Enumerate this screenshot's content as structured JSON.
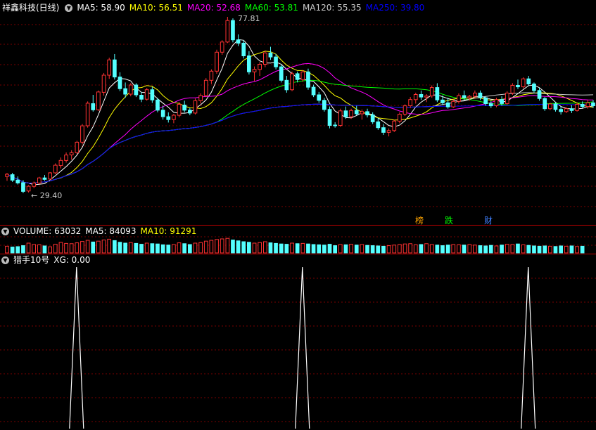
{
  "price_panel": {
    "title": "祥鑫科技(日线)",
    "ma_labels": [
      {
        "text": "MA5: 58.90",
        "color": "#ffffff"
      },
      {
        "text": "MA10: 56.51",
        "color": "#ffff00"
      },
      {
        "text": "MA20: 52.68",
        "color": "#ff00ff"
      },
      {
        "text": "MA60: 53.81",
        "color": "#00ff00"
      },
      {
        "text": "MA120: 55.35",
        "color": "#cccccc"
      },
      {
        "text": "MA250: 39.80",
        "color": "#0000ff"
      }
    ],
    "high_label": "77.81",
    "low_label": "← 29.40",
    "markers": [
      {
        "text": "榜",
        "color": "#ffa500"
      },
      {
        "text": "跌",
        "color": "#00ff00"
      },
      {
        "text": "财",
        "color": "#4080ff"
      }
    ]
  },
  "volume_panel": {
    "title": "VOLUME: 63032",
    "ma5": "MA5: 84093",
    "ma10": "MA10: 91291"
  },
  "indicator_panel": {
    "title": "猎手10号",
    "xg": "XG: 0.00"
  },
  "colors": {
    "up": "#ff3232",
    "down": "#54ffff",
    "grid": "#7a0000",
    "border": "#c00000"
  },
  "chart_data": {
    "type": "candlestick",
    "price_range": [
      29.4,
      77.81
    ],
    "candles": [
      {
        "o": 34.0,
        "h": 35.0,
        "l": 32.8,
        "c": 34.6
      },
      {
        "o": 34.5,
        "h": 35.0,
        "l": 32.5,
        "c": 33.0
      },
      {
        "o": 33.0,
        "h": 34.0,
        "l": 31.8,
        "c": 32.2
      },
      {
        "o": 32.3,
        "h": 33.0,
        "l": 29.4,
        "c": 29.9
      },
      {
        "o": 30.0,
        "h": 31.6,
        "l": 29.6,
        "c": 31.3
      },
      {
        "o": 31.3,
        "h": 32.6,
        "l": 30.8,
        "c": 32.2
      },
      {
        "o": 32.2,
        "h": 33.9,
        "l": 31.9,
        "c": 33.6
      },
      {
        "o": 33.6,
        "h": 34.4,
        "l": 32.8,
        "c": 33.2
      },
      {
        "o": 33.3,
        "h": 35.2,
        "l": 33.0,
        "c": 35.0
      },
      {
        "o": 35.0,
        "h": 37.6,
        "l": 34.6,
        "c": 37.1
      },
      {
        "o": 37.0,
        "h": 39.2,
        "l": 36.2,
        "c": 38.4
      },
      {
        "o": 38.4,
        "h": 40.6,
        "l": 37.8,
        "c": 39.9
      },
      {
        "o": 39.9,
        "h": 41.2,
        "l": 38.6,
        "c": 40.5
      },
      {
        "o": 40.5,
        "h": 43.8,
        "l": 40.1,
        "c": 43.4
      },
      {
        "o": 43.4,
        "h": 48.4,
        "l": 42.8,
        "c": 47.9
      },
      {
        "o": 47.9,
        "h": 54.6,
        "l": 47.4,
        "c": 54.1
      },
      {
        "o": 54.0,
        "h": 56.4,
        "l": 51.8,
        "c": 52.3
      },
      {
        "o": 52.3,
        "h": 57.6,
        "l": 52.0,
        "c": 57.2
      },
      {
        "o": 57.1,
        "h": 62.4,
        "l": 56.2,
        "c": 61.8
      },
      {
        "o": 61.8,
        "h": 66.6,
        "l": 60.8,
        "c": 66.0
      },
      {
        "o": 66.0,
        "h": 67.6,
        "l": 60.6,
        "c": 61.3
      },
      {
        "o": 61.3,
        "h": 62.6,
        "l": 57.4,
        "c": 58.1
      },
      {
        "o": 58.1,
        "h": 59.8,
        "l": 55.6,
        "c": 56.6
      },
      {
        "o": 56.6,
        "h": 59.6,
        "l": 56.0,
        "c": 59.1
      },
      {
        "o": 59.1,
        "h": 59.6,
        "l": 55.8,
        "c": 56.4
      },
      {
        "o": 56.3,
        "h": 57.2,
        "l": 54.4,
        "c": 55.2
      },
      {
        "o": 55.2,
        "h": 58.3,
        "l": 54.8,
        "c": 57.8
      },
      {
        "o": 57.8,
        "h": 58.6,
        "l": 54.2,
        "c": 55.0
      },
      {
        "o": 55.0,
        "h": 55.6,
        "l": 51.6,
        "c": 52.2
      },
      {
        "o": 52.2,
        "h": 53.4,
        "l": 49.6,
        "c": 50.4
      },
      {
        "o": 50.4,
        "h": 51.6,
        "l": 48.8,
        "c": 49.6
      },
      {
        "o": 49.6,
        "h": 51.2,
        "l": 48.6,
        "c": 50.8
      },
      {
        "o": 50.8,
        "h": 54.4,
        "l": 50.2,
        "c": 53.8
      },
      {
        "o": 53.6,
        "h": 54.8,
        "l": 51.6,
        "c": 52.2
      },
      {
        "o": 52.2,
        "h": 52.8,
        "l": 50.8,
        "c": 51.4
      },
      {
        "o": 51.4,
        "h": 55.4,
        "l": 51.0,
        "c": 54.8
      },
      {
        "o": 54.8,
        "h": 56.8,
        "l": 54.0,
        "c": 56.2
      },
      {
        "o": 56.2,
        "h": 61.0,
        "l": 55.8,
        "c": 60.4
      },
      {
        "o": 60.4,
        "h": 63.4,
        "l": 59.4,
        "c": 62.9
      },
      {
        "o": 62.9,
        "h": 68.8,
        "l": 62.2,
        "c": 68.1
      },
      {
        "o": 68.1,
        "h": 71.4,
        "l": 67.4,
        "c": 70.9
      },
      {
        "o": 70.9,
        "h": 77.81,
        "l": 70.6,
        "c": 76.8
      },
      {
        "o": 76.8,
        "h": 77.4,
        "l": 70.8,
        "c": 71.5
      },
      {
        "o": 71.5,
        "h": 73.0,
        "l": 69.8,
        "c": 70.6
      },
      {
        "o": 70.6,
        "h": 71.4,
        "l": 66.4,
        "c": 67.1
      },
      {
        "o": 67.1,
        "h": 68.4,
        "l": 62.0,
        "c": 62.7
      },
      {
        "o": 62.7,
        "h": 64.2,
        "l": 60.2,
        "c": 63.4
      },
      {
        "o": 63.4,
        "h": 65.4,
        "l": 61.6,
        "c": 64.8
      },
      {
        "o": 64.8,
        "h": 68.6,
        "l": 64.0,
        "c": 67.9
      },
      {
        "o": 67.9,
        "h": 69.6,
        "l": 66.0,
        "c": 66.8
      },
      {
        "o": 66.8,
        "h": 67.6,
        "l": 63.4,
        "c": 64.1
      },
      {
        "o": 64.1,
        "h": 64.8,
        "l": 59.8,
        "c": 60.4
      },
      {
        "o": 60.4,
        "h": 61.6,
        "l": 57.0,
        "c": 57.8
      },
      {
        "o": 57.8,
        "h": 62.8,
        "l": 57.4,
        "c": 62.2
      },
      {
        "o": 62.2,
        "h": 62.8,
        "l": 59.8,
        "c": 60.6
      },
      {
        "o": 60.6,
        "h": 63.2,
        "l": 60.0,
        "c": 62.7
      },
      {
        "o": 62.7,
        "h": 63.6,
        "l": 57.8,
        "c": 58.5
      },
      {
        "o": 58.5,
        "h": 59.2,
        "l": 55.8,
        "c": 56.4
      },
      {
        "o": 56.4,
        "h": 57.2,
        "l": 54.2,
        "c": 54.9
      },
      {
        "o": 54.9,
        "h": 55.6,
        "l": 51.8,
        "c": 52.4
      },
      {
        "o": 52.4,
        "h": 53.2,
        "l": 47.2,
        "c": 48.0
      },
      {
        "o": 48.1,
        "h": 48.9,
        "l": 47.4,
        "c": 48.0
      },
      {
        "o": 48.0,
        "h": 52.6,
        "l": 47.6,
        "c": 52.0
      },
      {
        "o": 52.0,
        "h": 53.2,
        "l": 49.8,
        "c": 50.4
      },
      {
        "o": 50.4,
        "h": 52.6,
        "l": 49.8,
        "c": 52.1
      },
      {
        "o": 52.1,
        "h": 53.4,
        "l": 50.8,
        "c": 51.2
      },
      {
        "o": 51.2,
        "h": 52.4,
        "l": 49.6,
        "c": 51.8
      },
      {
        "o": 51.8,
        "h": 52.6,
        "l": 50.2,
        "c": 50.9
      },
      {
        "o": 50.9,
        "h": 51.6,
        "l": 48.4,
        "c": 49.0
      },
      {
        "o": 49.0,
        "h": 50.0,
        "l": 46.8,
        "c": 47.4
      },
      {
        "o": 47.4,
        "h": 48.4,
        "l": 45.4,
        "c": 46.1
      },
      {
        "o": 46.1,
        "h": 47.2,
        "l": 45.0,
        "c": 46.6
      },
      {
        "o": 46.6,
        "h": 49.6,
        "l": 46.2,
        "c": 49.2
      },
      {
        "o": 49.2,
        "h": 51.6,
        "l": 48.6,
        "c": 51.1
      },
      {
        "o": 51.1,
        "h": 53.8,
        "l": 50.6,
        "c": 53.4
      },
      {
        "o": 53.4,
        "h": 55.8,
        "l": 52.8,
        "c": 55.1
      },
      {
        "o": 55.1,
        "h": 57.0,
        "l": 54.0,
        "c": 56.5
      },
      {
        "o": 56.5,
        "h": 57.6,
        "l": 55.0,
        "c": 55.8
      },
      {
        "o": 55.8,
        "h": 56.6,
        "l": 54.4,
        "c": 56.1
      },
      {
        "o": 56.1,
        "h": 59.0,
        "l": 55.6,
        "c": 58.4
      },
      {
        "o": 58.4,
        "h": 59.6,
        "l": 54.4,
        "c": 55.0
      },
      {
        "o": 55.0,
        "h": 56.2,
        "l": 53.6,
        "c": 54.2
      },
      {
        "o": 54.2,
        "h": 55.6,
        "l": 52.6,
        "c": 53.1
      },
      {
        "o": 53.1,
        "h": 55.2,
        "l": 52.8,
        "c": 54.6
      },
      {
        "o": 54.6,
        "h": 56.8,
        "l": 54.0,
        "c": 56.2
      },
      {
        "o": 56.2,
        "h": 57.6,
        "l": 55.0,
        "c": 55.6
      },
      {
        "o": 55.6,
        "h": 56.4,
        "l": 54.8,
        "c": 56.0
      },
      {
        "o": 56.0,
        "h": 57.6,
        "l": 55.4,
        "c": 56.9
      },
      {
        "o": 56.9,
        "h": 57.6,
        "l": 55.0,
        "c": 55.6
      },
      {
        "o": 55.6,
        "h": 56.0,
        "l": 53.4,
        "c": 54.0
      },
      {
        "o": 54.0,
        "h": 54.8,
        "l": 52.8,
        "c": 53.4
      },
      {
        "o": 53.4,
        "h": 55.6,
        "l": 53.0,
        "c": 55.1
      },
      {
        "o": 55.1,
        "h": 56.0,
        "l": 53.4,
        "c": 54.0
      },
      {
        "o": 54.0,
        "h": 57.4,
        "l": 53.6,
        "c": 56.9
      },
      {
        "o": 56.9,
        "h": 59.6,
        "l": 56.4,
        "c": 59.0
      },
      {
        "o": 59.0,
        "h": 60.6,
        "l": 58.0,
        "c": 58.6
      },
      {
        "o": 58.6,
        "h": 61.2,
        "l": 58.2,
        "c": 60.8
      },
      {
        "o": 60.8,
        "h": 61.6,
        "l": 58.8,
        "c": 59.4
      },
      {
        "o": 59.4,
        "h": 59.8,
        "l": 57.0,
        "c": 57.6
      },
      {
        "o": 57.6,
        "h": 58.4,
        "l": 54.8,
        "c": 55.4
      },
      {
        "o": 55.4,
        "h": 55.8,
        "l": 52.0,
        "c": 52.6
      },
      {
        "o": 52.6,
        "h": 54.2,
        "l": 52.2,
        "c": 53.9
      },
      {
        "o": 53.9,
        "h": 54.4,
        "l": 51.8,
        "c": 52.4
      },
      {
        "o": 52.4,
        "h": 53.2,
        "l": 51.0,
        "c": 51.8
      },
      {
        "o": 51.8,
        "h": 53.0,
        "l": 51.4,
        "c": 52.6
      },
      {
        "o": 52.6,
        "h": 53.6,
        "l": 51.4,
        "c": 52.1
      },
      {
        "o": 52.1,
        "h": 54.4,
        "l": 51.8,
        "c": 53.8
      },
      {
        "o": 53.8,
        "h": 54.6,
        "l": 52.8,
        "c": 53.2
      },
      {
        "o": 53.2,
        "h": 55.0,
        "l": 52.6,
        "c": 54.2
      },
      {
        "o": 54.2,
        "h": 55.0,
        "l": 52.8,
        "c": 53.4
      }
    ],
    "volume": [
      48,
      42,
      45,
      52,
      70,
      60,
      58,
      50,
      44,
      62,
      75,
      68,
      66,
      72,
      82,
      90,
      78,
      84,
      92,
      98,
      88,
      76,
      70,
      74,
      68,
      62,
      70,
      66,
      64,
      58,
      56,
      60,
      72,
      66,
      60,
      70,
      74,
      84,
      90,
      96,
      100,
      104,
      92,
      86,
      80,
      76,
      70,
      74,
      80,
      72,
      68,
      64,
      62,
      70,
      66,
      68,
      64,
      60,
      58,
      56,
      62,
      52,
      60,
      58,
      62,
      56,
      60,
      54,
      52,
      50,
      48,
      52,
      56,
      60,
      64,
      66,
      58,
      60,
      66,
      60,
      56,
      52,
      56,
      60,
      58,
      56,
      60,
      56,
      52,
      50,
      54,
      50,
      56,
      62,
      60,
      64,
      58,
      54,
      50,
      48,
      50,
      48,
      46,
      50,
      48,
      50,
      46,
      48
    ],
    "volume_range": [
      0,
      110
    ],
    "xg_signal_candles": [
      9,
      51,
      93
    ]
  }
}
